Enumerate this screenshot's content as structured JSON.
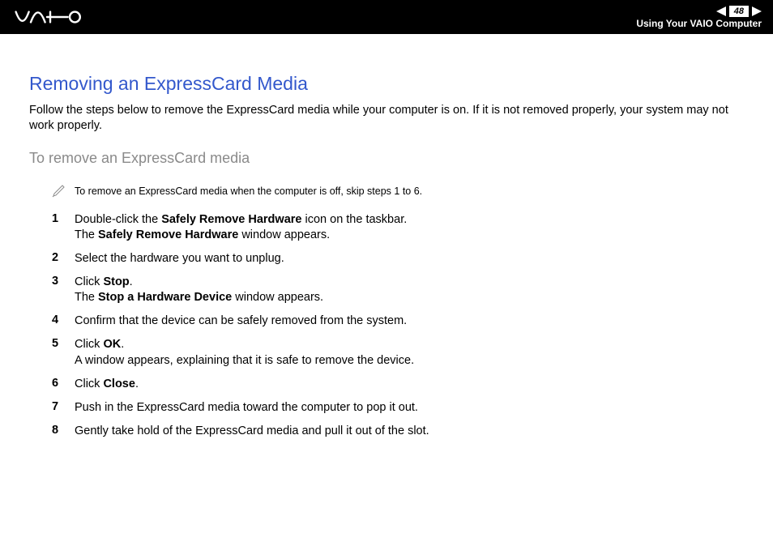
{
  "header": {
    "page_number": "48",
    "section_label": "Using Your VAIO Computer"
  },
  "title": "Removing an ExpressCard Media",
  "intro": "Follow the steps below to remove the ExpressCard media while your computer is on. If it is not removed properly, your system may not work properly.",
  "subtitle": "To remove an ExpressCard media",
  "note": "To remove an ExpressCard media when the computer is off, skip steps 1 to 6.",
  "steps": [
    {
      "n": "1",
      "html": "Double-click the <b>Safely Remove Hardware</b> icon on the taskbar.<br>The <b>Safely Remove Hardware</b> window appears."
    },
    {
      "n": "2",
      "html": "Select the hardware you want to unplug."
    },
    {
      "n": "3",
      "html": "Click <b>Stop</b>.<br>The <b>Stop a Hardware Device</b> window appears."
    },
    {
      "n": "4",
      "html": "Confirm that the device can be safely removed from the system."
    },
    {
      "n": "5",
      "html": "Click <b>OK</b>.<br>A window appears, explaining that it is safe to remove the device."
    },
    {
      "n": "6",
      "html": "Click <b>Close</b>."
    },
    {
      "n": "7",
      "html": "Push in the ExpressCard media toward the computer to pop it out."
    },
    {
      "n": "8",
      "html": "Gently take hold of the ExpressCard media and pull it out of the slot."
    }
  ]
}
